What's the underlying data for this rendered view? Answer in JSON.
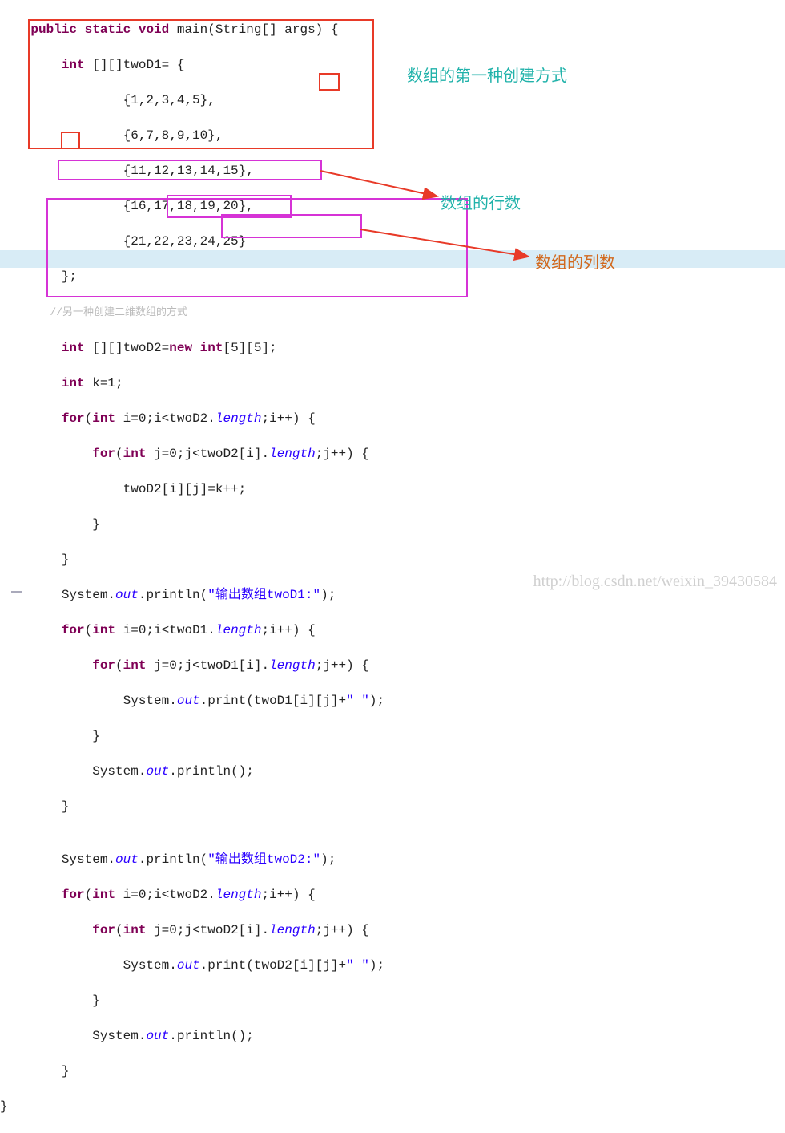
{
  "code": {
    "l1a": "public",
    "l1b": "static",
    "l1c": "void",
    "l1d": " main(String[] args) {",
    "l2a": "int",
    "l2b": " [][]twoD1= {",
    "l3": "                {1,2,3,4,5},",
    "l4": "                {6,7,8,9,10},",
    "l5": "                {11,12,13,14,15},",
    "l6": "                {16,17,18,19,20},",
    "l7": "                {21,22,23,24,25}",
    "l8": "        };",
    "l9": "        //另一种创建二维数组的方式",
    "l10a": "int",
    "l10b": " [][]twoD2=",
    "l10c": "new",
    "l10d": " ",
    "l10e": "int",
    "l10f": "[5][5];",
    "l11a": "int",
    "l11b": " k=1;",
    "l12a": "for",
    "l12b": "(",
    "l12c": "int",
    "l12d": " i=0;i<twoD2.",
    "l12e": "length",
    "l12f": ";i++) {",
    "l13a": "for",
    "l13b": "(",
    "l13c": "int",
    "l13d": " j=0;j<twoD2[i].",
    "l13e": "length",
    "l13f": ";j++) {",
    "l14": "                twoD2[i][j]=k++;",
    "l15": "            }",
    "l16": "        }",
    "l17a": "        System.",
    "l17b": "out",
    "l17c": ".println(",
    "l17d": "\"输出数组twoD1:\"",
    "l17e": ");",
    "l18a": "for",
    "l18b": "(",
    "l18c": "int",
    "l18d": " i=0;i<twoD1.",
    "l18e": "length",
    "l18f": ";i++) {",
    "l19a": "for",
    "l19b": "(",
    "l19c": "int",
    "l19d": " j=0;j<twoD1[i].",
    "l19e": "length",
    "l19f": ";j++) {",
    "l20a": "                System.",
    "l20b": "out",
    "l20c": ".print(twoD1[i][j]+",
    "l20d": "\" \"",
    "l20e": ");",
    "l21": "            }",
    "l22a": "            System.",
    "l22b": "out",
    "l22c": ".println();",
    "l23": "        }",
    "l24": "",
    "l25a": "        System.",
    "l25b": "out",
    "l25c": ".println(",
    "l25d": "\"输出数组twoD2:\"",
    "l25e": ");",
    "l26a": "for",
    "l26b": "(",
    "l26c": "int",
    "l26d": " i=0;i<twoD2.",
    "l26e": "length",
    "l26f": ";i++) {",
    "l27a": "for",
    "l27b": "(",
    "l27c": "int",
    "l27d": " j=0;j<twoD2[i].",
    "l27e": "length",
    "l27f": ";j++) {",
    "l28a": "                System.",
    "l28b": "out",
    "l28c": ".print(twoD2[i][j]+",
    "l28d": "\" \"",
    "l28e": ");",
    "l29": "            }",
    "l30a": "            System.",
    "l30b": "out",
    "l30c": ".println();",
    "l31": "        }",
    "l32": "}"
  },
  "annotations": {
    "first_way": "数组的第一种创建方式",
    "rows": "数组的行数",
    "cols": "数组的列数"
  },
  "watermark": "http://blog.csdn.net/weixin_39430584"
}
